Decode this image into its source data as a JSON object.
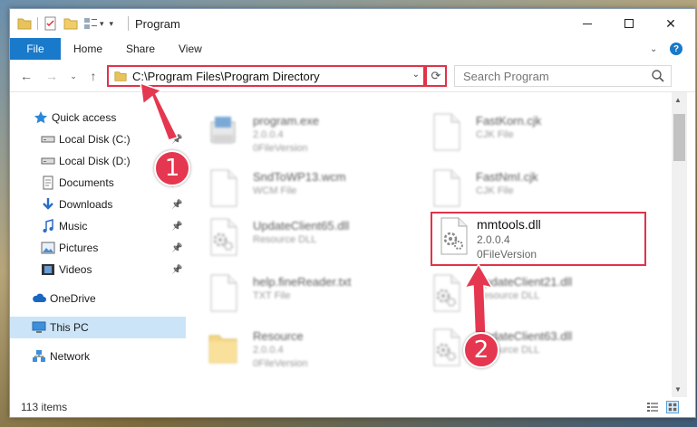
{
  "window": {
    "title": "Program",
    "controls": [
      "minimize",
      "maximize",
      "close"
    ]
  },
  "ribbon": {
    "tabs": [
      "File",
      "Home",
      "Share",
      "View"
    ],
    "help": "?"
  },
  "navbar": {
    "address": "C:\\Program Files\\Program Directory",
    "search_placeholder": "Search Program"
  },
  "sidebar": {
    "items": [
      {
        "label": "Quick access",
        "icon": "star-icon",
        "pinned": false
      },
      {
        "label": "Local Disk (C:)",
        "icon": "drive-icon",
        "pinned": true
      },
      {
        "label": "Local Disk (D:)",
        "icon": "drive-icon",
        "pinned": true
      },
      {
        "label": "Documents",
        "icon": "documents-icon",
        "pinned": true
      },
      {
        "label": "Downloads",
        "icon": "download-icon",
        "pinned": true
      },
      {
        "label": "Music",
        "icon": "music-icon",
        "pinned": true
      },
      {
        "label": "Pictures",
        "icon": "pictures-icon",
        "pinned": true
      },
      {
        "label": "Videos",
        "icon": "videos-icon",
        "pinned": true
      },
      {
        "label": "OneDrive",
        "icon": "cloud-icon",
        "pinned": false
      },
      {
        "label": "This PC",
        "icon": "computer-icon",
        "pinned": false,
        "selected": true
      },
      {
        "label": "Network",
        "icon": "network-icon",
        "pinned": false
      }
    ]
  },
  "files": [
    {
      "name": "program.exe",
      "type": "2.0.0.4",
      "version": "0FileVersion",
      "icon": "exe-icon"
    },
    {
      "name": "FastKorn.cjk",
      "type": "CJK File",
      "version": "",
      "icon": "blank-file-icon"
    },
    {
      "name": "SndToWP13.wcm",
      "type": "WCM File",
      "version": "",
      "icon": "blank-file-icon"
    },
    {
      "name": "FastNmI.cjk",
      "type": "CJK File",
      "version": "",
      "icon": "blank-file-icon"
    },
    {
      "name": "UpdateClient65.dll",
      "type": "Resource DLL",
      "version": "",
      "icon": "dll-icon"
    },
    {
      "name": "mmtools.dll",
      "type": "2.0.0.4",
      "version": "0FileVersion",
      "icon": "dll-icon",
      "highlighted": true
    },
    {
      "name": "help.fineReader.txt",
      "type": "TXT File",
      "version": "",
      "icon": "blank-file-icon"
    },
    {
      "name": "UpdateClient21.dll",
      "type": "Resource DLL",
      "version": "",
      "icon": "dll-icon"
    },
    {
      "name": "Resource",
      "type": "2.0.0.4",
      "version": "0FileVersion",
      "icon": "folder-icon"
    },
    {
      "name": "UpdateClient63.dll",
      "type": "Resource DLL",
      "version": "",
      "icon": "dll-icon"
    }
  ],
  "status": {
    "item_count": "113 items"
  },
  "annotations": {
    "step1": "1",
    "step2": "2",
    "color": "#e53750"
  }
}
